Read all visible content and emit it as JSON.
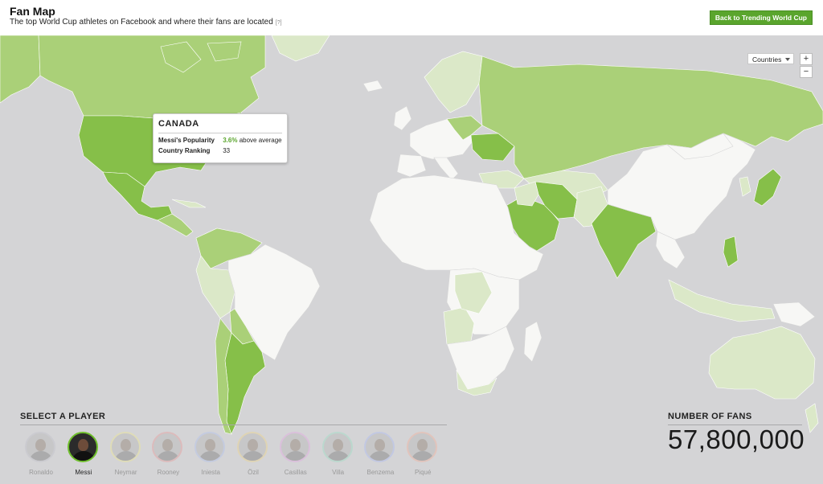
{
  "header": {
    "title": "Fan Map",
    "subtitle": "The top World Cup athletes on Facebook and where their fans are located",
    "help": "[?]",
    "back_button": "Back to Trending World Cup"
  },
  "map_controls": {
    "view_select": "Countries",
    "zoom_in": "+",
    "zoom_out": "−"
  },
  "tooltip": {
    "country": "CANADA",
    "popularity_label": "Messi's Popularity",
    "popularity_value": "3.6%",
    "popularity_suffix": "above average",
    "ranking_label": "Country Ranking",
    "ranking_value": "33"
  },
  "player_select": {
    "label": "SELECT A PLAYER",
    "players": [
      {
        "name": "Ronaldo",
        "selected": false,
        "ring_color": "#c4c4cc"
      },
      {
        "name": "Messi",
        "selected": true,
        "ring_color": "#6fbf2c"
      },
      {
        "name": "Neymar",
        "selected": false,
        "ring_color": "#e8e4a0"
      },
      {
        "name": "Rooney",
        "selected": false,
        "ring_color": "#e3a8a8"
      },
      {
        "name": "Iniesta",
        "selected": false,
        "ring_color": "#b8c4e8"
      },
      {
        "name": "Özil",
        "selected": false,
        "ring_color": "#e8d49a"
      },
      {
        "name": "Casillas",
        "selected": false,
        "ring_color": "#e0b0e0"
      },
      {
        "name": "Villa",
        "selected": false,
        "ring_color": "#a8dcc8"
      },
      {
        "name": "Benzema",
        "selected": false,
        "ring_color": "#b4c0ec"
      },
      {
        "name": "Piqué",
        "selected": false,
        "ring_color": "#ecb8a8"
      }
    ]
  },
  "fans": {
    "label": "NUMBER OF FANS",
    "value": "57,800,000"
  },
  "colors": {
    "ocean": "#d4d4d6",
    "land_white": "#f7f7f5",
    "land_light": "#dbe8c8",
    "land_mid": "#aad078",
    "land_strong": "#86bf49",
    "accent": "#5aa52d"
  }
}
